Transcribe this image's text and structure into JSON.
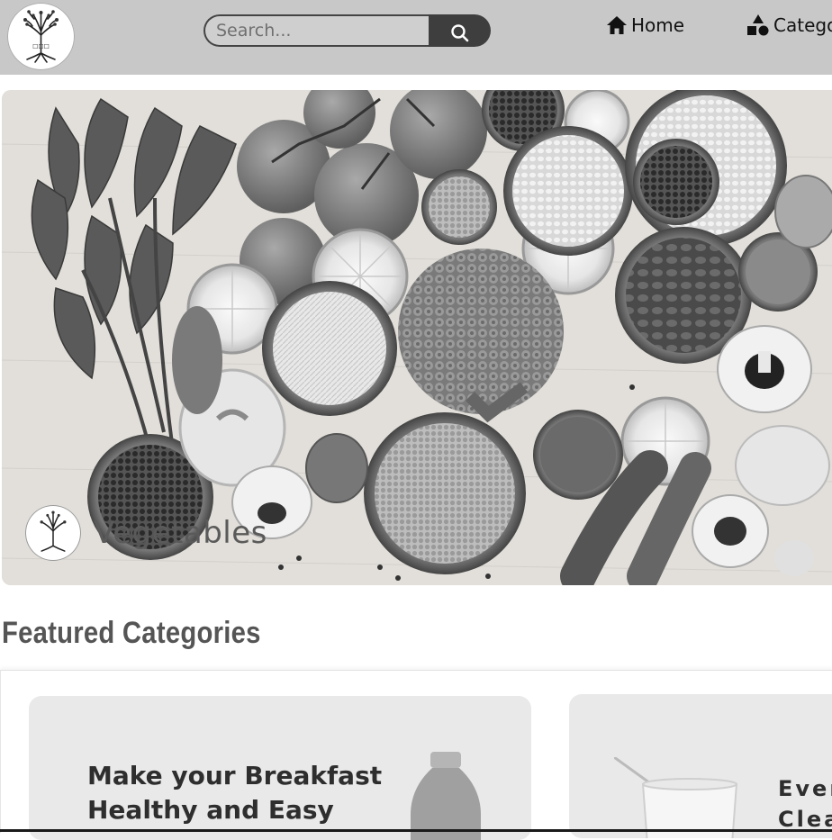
{
  "header": {
    "search_placeholder": "Search...",
    "nav": [
      {
        "label": "Home",
        "icon": "home-icon"
      },
      {
        "label": "Catego",
        "icon": "shapes-icon"
      }
    ]
  },
  "hero": {
    "caption": "Vegetables"
  },
  "featured": {
    "title": "Featured Categories",
    "cards": [
      {
        "title": "Make your Breakfast Healthy and Easy"
      },
      {
        "title": "Ever Clea"
      }
    ]
  }
}
